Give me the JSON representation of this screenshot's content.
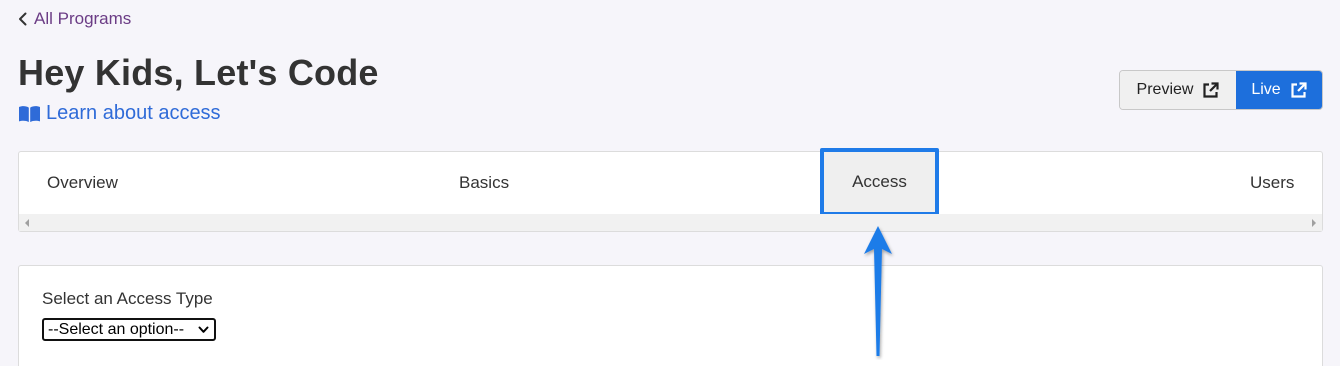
{
  "nav": {
    "back_label": "All Programs"
  },
  "header": {
    "title": "Hey Kids, Let's Code",
    "learn_link_label": "Learn about access"
  },
  "actions": {
    "preview_label": "Preview",
    "live_label": "Live"
  },
  "tabs": [
    {
      "label": "Overview",
      "active": false
    },
    {
      "label": "Basics",
      "active": false
    },
    {
      "label": "Access",
      "active": true
    },
    {
      "label": "Users",
      "active": false
    }
  ],
  "access_form": {
    "label": "Select an Access Type",
    "select_value": "--Select an option--"
  },
  "colors": {
    "link_purple": "#6b3c85",
    "link_blue": "#2f6bd8",
    "primary_button": "#1d6fdc",
    "highlight_border": "#1f7be8",
    "annotation_arrow": "#1f7be8"
  },
  "icons": {
    "back": "chevron-left-icon",
    "learn": "book-open-icon",
    "external": "external-link-icon",
    "select": "chevron-down-icon"
  }
}
